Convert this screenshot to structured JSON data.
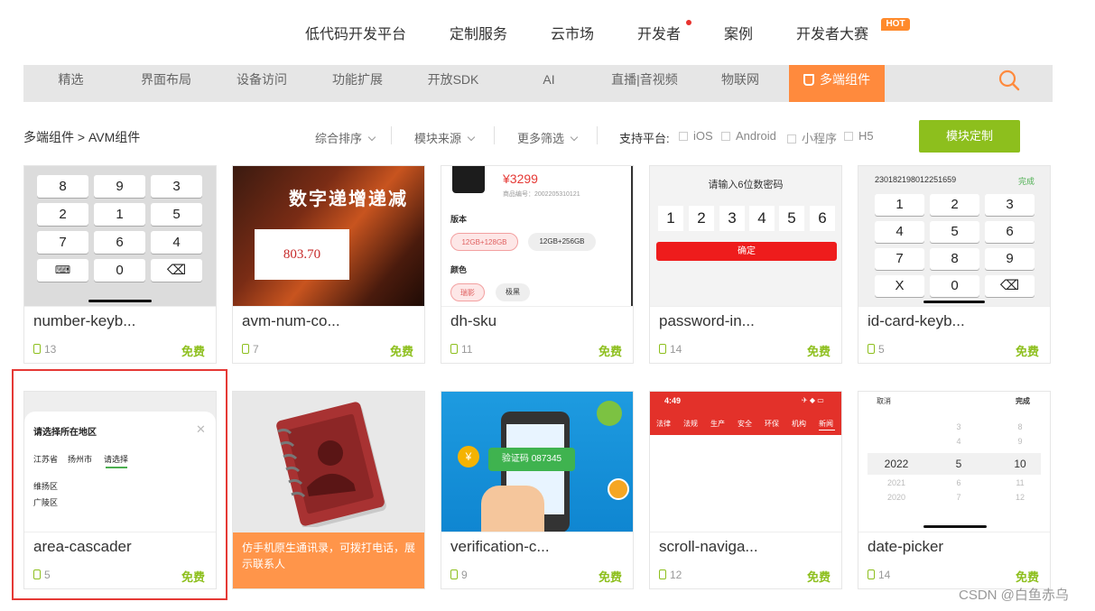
{
  "topnav": {
    "items": [
      "低代码开发平台",
      "定制服务",
      "云市场",
      "开发者",
      "案例",
      "开发者大赛"
    ],
    "hot_badge": "HOT"
  },
  "categories": {
    "items": [
      "精选",
      "界面布局",
      "设备访问",
      "功能扩展",
      "开放SDK",
      "AI",
      "直播|音视频",
      "物联网",
      "多端组件"
    ],
    "active_index": 8,
    "accent": "#ff8a3d"
  },
  "breadcrumb": "多端组件 > AVM组件",
  "filters": [
    "综合排序",
    "模块来源",
    "更多筛选"
  ],
  "platform": {
    "label": "支持平台:",
    "options": [
      "iOS",
      "Android",
      "小程序",
      "H5"
    ]
  },
  "custom_button": "模块定制",
  "price_color": "#8dbf1d",
  "cards": [
    {
      "name": "number-keyb...",
      "count": "13",
      "price": "免费"
    },
    {
      "name": "avm-num-co...",
      "count": "7",
      "price": "免费"
    },
    {
      "name": "dh-sku",
      "count": "11",
      "price": "免费"
    },
    {
      "name": "password-in...",
      "count": "14",
      "price": "免费"
    },
    {
      "name": "id-card-keyb...",
      "count": "5",
      "price": "免费"
    },
    {
      "name": "area-cascader",
      "count": "5",
      "price": "免费"
    },
    {
      "name": "",
      "count": "",
      "price": ""
    },
    {
      "name": "verification-c...",
      "count": "9",
      "price": "免费"
    },
    {
      "name": "scroll-naviga...",
      "count": "12",
      "price": "免费"
    },
    {
      "name": "date-picker",
      "count": "14",
      "price": "免费"
    }
  ],
  "thumbs": {
    "numkbd": {
      "keys": [
        "8",
        "9",
        "3",
        "2",
        "1",
        "5",
        "7",
        "6",
        "4",
        "⌨",
        "0",
        "⌫"
      ]
    },
    "numcount": {
      "title": "数字递增递减",
      "value": "803.70"
    },
    "sku": {
      "price": "¥3299",
      "code": "商品编号：2002205310121",
      "spec_label": "版本",
      "spec1": "12GB+128GB",
      "spec2": "12GB+256GB",
      "color_label": "颜色",
      "color1": "瑞影",
      "color2": "极黑"
    },
    "password": {
      "title": "请输入6位数密码",
      "digits": [
        "1",
        "2",
        "3",
        "4",
        "5",
        "6"
      ],
      "confirm": "确定"
    },
    "idcard": {
      "number": "230182198012251659",
      "done": "完成",
      "keys": [
        "1",
        "2",
        "3",
        "4",
        "5",
        "6",
        "7",
        "8",
        "9",
        "X",
        "0",
        "⌫"
      ]
    },
    "area": {
      "title": "请选择所在地区",
      "close": "✕",
      "tabs": [
        "江苏省",
        "扬州市",
        "请选择"
      ],
      "options": [
        "维扬区",
        "广陵区"
      ]
    },
    "contacts": {
      "caption": "仿手机原生通讯录，可拨打电话，展示联系人"
    },
    "verify": {
      "code": "验证码 087345"
    },
    "scroll": {
      "time": "4:49",
      "status": "✈ ◆ ▭",
      "tabs": [
        "法律",
        "法规",
        "生产",
        "安全",
        "环保",
        "机构",
        "新闻"
      ]
    },
    "date": {
      "cancel": "取消",
      "done": "完成",
      "years": [
        "",
        "",
        "",
        "2022",
        "2021",
        "2020"
      ],
      "months": [
        "3",
        "4",
        "",
        "5",
        "6",
        "7"
      ],
      "days": [
        "8",
        "9",
        "",
        "10",
        "11",
        "12"
      ]
    }
  },
  "watermark": "CSDN @白鱼赤乌"
}
